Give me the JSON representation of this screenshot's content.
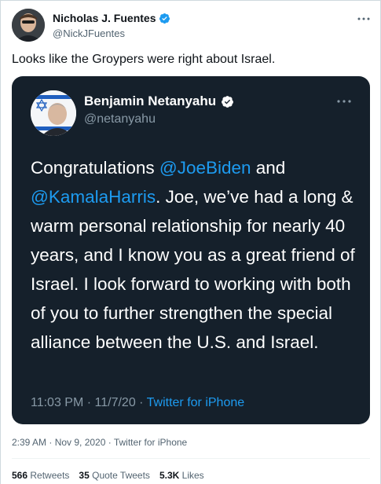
{
  "tweet": {
    "author": {
      "display_name": "Nicholas J. Fuentes",
      "handle": "@NickJFuentes",
      "verified": true
    },
    "more_icon": "ellipsis-icon",
    "text": "Looks like the Groypers were right about Israel.",
    "timestamp": "2:39 AM · Nov 9, 2020 · Twitter for iPhone",
    "stats": {
      "retweets_count": "566",
      "retweets_label": "Retweets",
      "quotes_count": "35",
      "quotes_label": "Quote Tweets",
      "likes_count": "5.3K",
      "likes_label": "Likes"
    }
  },
  "quoted_tweet": {
    "author": {
      "display_name": "Benjamin Netanyahu",
      "handle": "@netanyahu",
      "verified": true
    },
    "more_icon": "ellipsis-icon",
    "body": {
      "part1": "Congratulations ",
      "mention1": "@JoeBiden",
      "part2": " and ",
      "mention2": "@KamalaHarris",
      "part3": ". Joe, we’ve had a long & warm personal relationship for nearly 40 years, and I know you as a great friend of Israel. I look forward to working with both of you to further strengthen the special alliance between the U.S. and Israel."
    },
    "time": "11:03 PM · 11/7/20 · ",
    "source": "Twitter for iPhone"
  },
  "colors": {
    "accent": "#1d9bf0",
    "quote_background": "#15202b",
    "secondary_text": "#536471"
  }
}
